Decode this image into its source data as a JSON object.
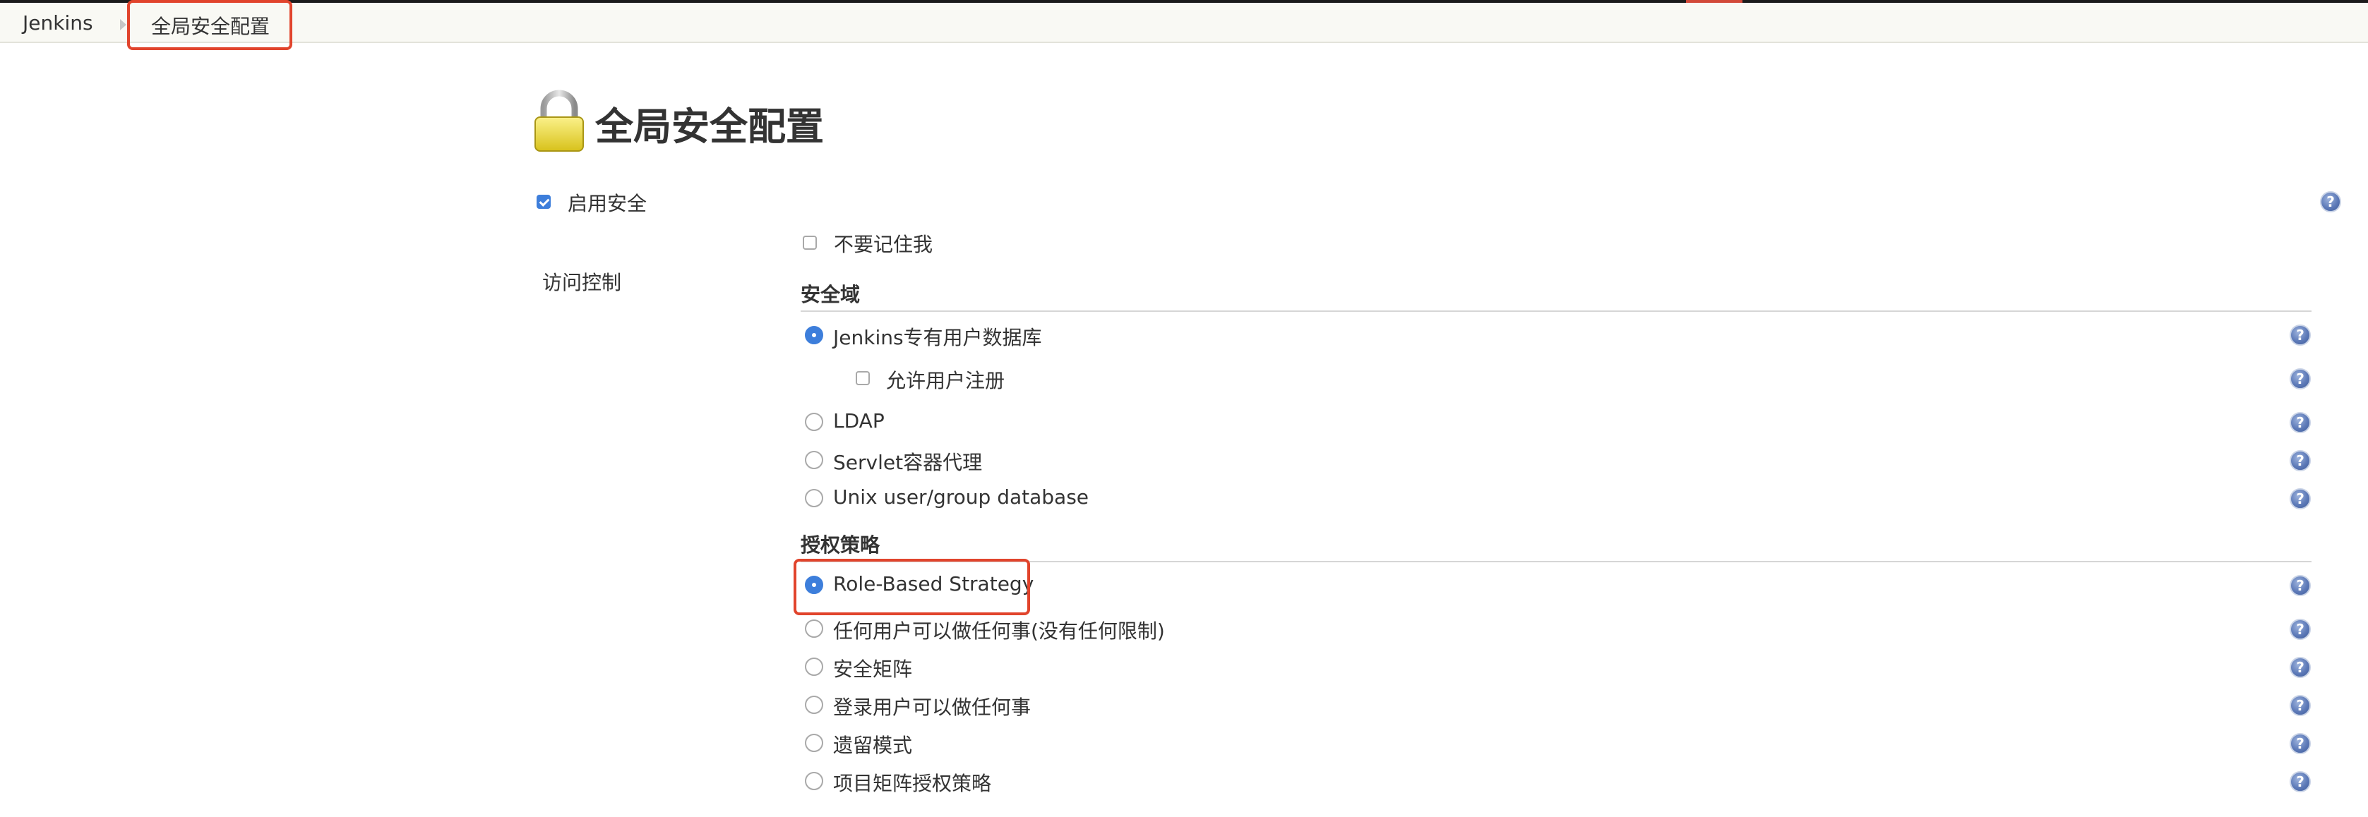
{
  "breadcrumb": {
    "root": "Jenkins",
    "current": "全局安全配置"
  },
  "page": {
    "title": "全局安全配置"
  },
  "enable_security": {
    "label": "启用安全",
    "checked": true
  },
  "access_control": {
    "label": "访问控制",
    "dont_remember_me": {
      "label": "不要记住我",
      "checked": false
    }
  },
  "security_realm": {
    "heading": "安全域",
    "options": [
      {
        "label": "Jenkins专有用户数据库",
        "selected": true
      },
      {
        "label": "LDAP",
        "selected": false
      },
      {
        "label": "Servlet容器代理",
        "selected": false
      },
      {
        "label": "Unix user/group database",
        "selected": false
      }
    ],
    "allow_signup": {
      "label": "允许用户注册",
      "checked": false
    }
  },
  "authorization": {
    "heading": "授权策略",
    "options": [
      {
        "label": "Role-Based Strategy",
        "selected": true
      },
      {
        "label": "任何用户可以做任何事(没有任何限制)",
        "selected": false
      },
      {
        "label": "安全矩阵",
        "selected": false
      },
      {
        "label": "登录用户可以做任何事",
        "selected": false
      },
      {
        "label": "遗留模式",
        "selected": false
      },
      {
        "label": "项目矩阵授权策略",
        "selected": false
      }
    ]
  },
  "icons": {
    "help": "help-icon",
    "lock": "lock-icon",
    "help_glyph": "?"
  },
  "colors": {
    "accent": "#3d7edb",
    "highlight": "#e1442c",
    "help": "#5d7ab8"
  }
}
